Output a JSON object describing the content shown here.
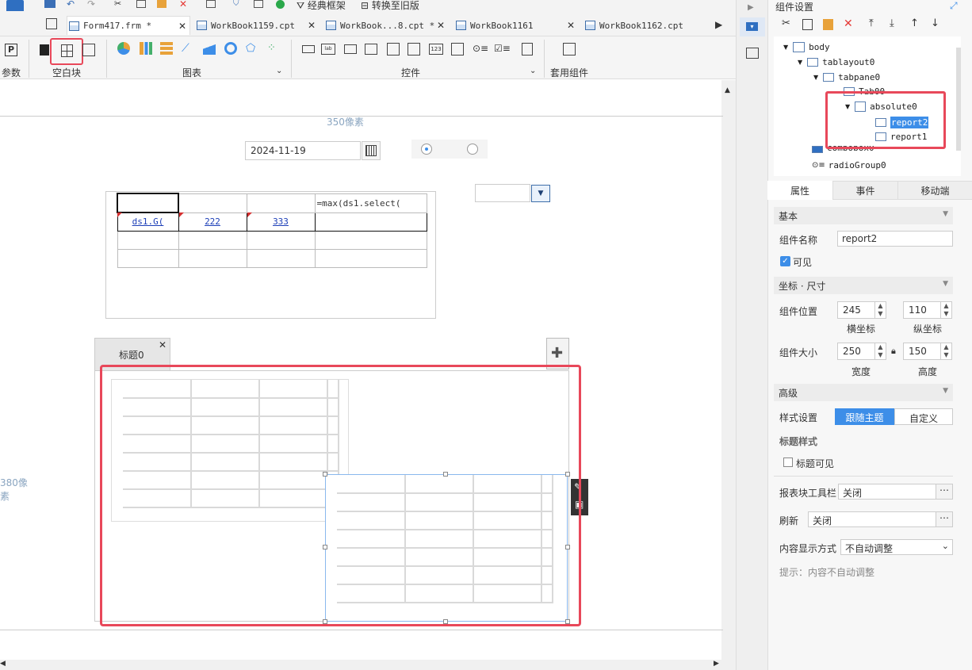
{
  "ribbon": {
    "classic_frame": "经典框架",
    "switch_old": "转换至旧版",
    "params_label": "参数",
    "blank_block_label": "空白块",
    "chart_label": "图表",
    "widget_label": "控件",
    "template_widget_label": "套用组件"
  },
  "tabs": [
    {
      "label": "Form417.frm *"
    },
    {
      "label": "WorkBook1159.cpt"
    },
    {
      "label": "WorkBook...8.cpt *"
    },
    {
      "label": "WorkBook1161"
    },
    {
      "label": "WorkBook1162.cpt"
    }
  ],
  "canvas": {
    "width_marker": "350像素",
    "height_marker": "380像素",
    "date_value": "2024-11-19",
    "report_cells": {
      "r0c3": "=max(ds1.select(",
      "r1c0": "ds1.G(",
      "r1c1": "222",
      "r1c2": "333"
    },
    "tab_title": "标题0"
  },
  "panel": {
    "header": "组件设置",
    "tree": [
      {
        "label": "body"
      },
      {
        "label": "tablayout0"
      },
      {
        "label": "tabpane0"
      },
      {
        "label": "Tab00"
      },
      {
        "label": "absolute0"
      },
      {
        "label": "report2"
      },
      {
        "label": "report1"
      },
      {
        "label": "combobox0"
      },
      {
        "label": "radioGroup0"
      }
    ],
    "tabs": {
      "attr": "属性",
      "event": "事件",
      "mobile": "移动端"
    },
    "basic": "基本",
    "name_label": "组件名称",
    "name_value": "report2",
    "visible_label": "可见",
    "coord_size": "坐标 · 尺寸",
    "pos_label": "组件位置",
    "x_value": "245",
    "y_value": "110",
    "x_caption": "横坐标",
    "y_caption": "纵坐标",
    "size_label": "组件大小",
    "w_value": "250",
    "h_value": "150",
    "w_caption": "宽度",
    "h_caption": "高度",
    "advanced": "高级",
    "style_label": "样式设置",
    "style_follow": "跟随主题",
    "style_custom": "自定义",
    "title_style": "标题样式",
    "title_visible": "标题可见",
    "toolbar_label": "报表块工具栏",
    "toolbar_value": "关闭",
    "refresh_label": "刷新",
    "refresh_value": "关闭",
    "content_label": "内容显示方式",
    "content_value": "不自动调整",
    "hint": "提示：内容不自动调整"
  },
  "colors": {
    "highlight": "#e8485a",
    "accent": "#3d8ee8",
    "selection": "#8ab8ee"
  }
}
